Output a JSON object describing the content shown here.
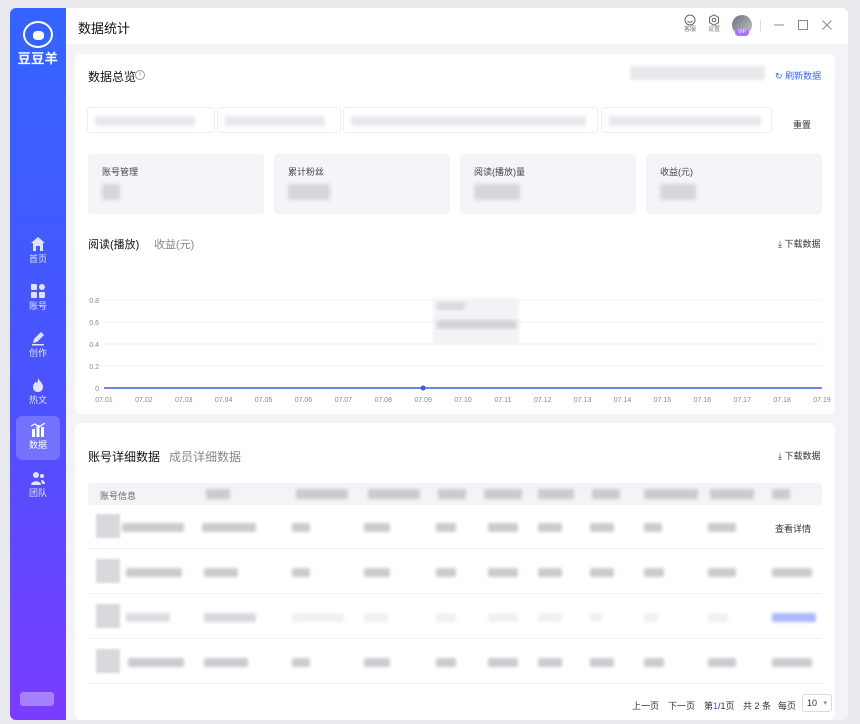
{
  "app": {
    "logo_text": "豆豆羊"
  },
  "sidebar": {
    "items": [
      {
        "label": "首页",
        "icon": "home-icon"
      },
      {
        "label": "账号",
        "icon": "grid-icon"
      },
      {
        "label": "创作",
        "icon": "pen-icon"
      },
      {
        "label": "热文",
        "icon": "flame-icon"
      },
      {
        "label": "数据",
        "icon": "bar-chart-icon",
        "active": true
      },
      {
        "label": "团队",
        "icon": "team-icon"
      }
    ]
  },
  "topbar": {
    "title": "数据统计",
    "service_label": "客服",
    "settings_label": "设置",
    "vip_badge": "VIP"
  },
  "overview": {
    "title": "数据总览",
    "refresh_label": "刷新数据",
    "reset_label": "重置",
    "stats": [
      {
        "label": "账号管理"
      },
      {
        "label": "累计粉丝"
      },
      {
        "label": "阅读(播放)量"
      },
      {
        "label": "收益(元)"
      }
    ],
    "tabs": [
      "阅读(播放)",
      "收益(元)"
    ],
    "download_label": "下载数据"
  },
  "chart_data": {
    "type": "line",
    "x": [
      "07.01",
      "07.02",
      "07.03",
      "07.04",
      "07.05",
      "07.06",
      "07.07",
      "07.08",
      "07.09",
      "07.10",
      "07.11",
      "07.12",
      "07.13",
      "07.14",
      "07.15",
      "07.16",
      "07.17",
      "07.18",
      "07.19"
    ],
    "series": [
      {
        "values": [
          0,
          0,
          0,
          0,
          0,
          0,
          0,
          0,
          0,
          0,
          0,
          0,
          0,
          0,
          0,
          0,
          0,
          0,
          0
        ]
      }
    ],
    "yticks": [
      "0.8",
      "0.6",
      "0.4",
      "0.2",
      "0"
    ],
    "ylim": [
      0,
      1
    ],
    "highlight_index": 8,
    "line_color": "#3d5bd9"
  },
  "details": {
    "tabs": [
      "账号详细数据",
      "成员详细数据"
    ],
    "download_label": "下载数据",
    "table_header_first": "账号信息",
    "row_action": "查看详情",
    "pager": {
      "prev": "上一页",
      "next": "下一页",
      "page_prefix": "第",
      "page_current": "1",
      "page_suffix": "/1页",
      "total": "共 2 条",
      "per_page_label": "每页",
      "per_page_value": "10"
    }
  },
  "colors": {
    "accent": "#3366ff",
    "sidebar_top": "#3464ff",
    "sidebar_bottom": "#7b3cff"
  }
}
